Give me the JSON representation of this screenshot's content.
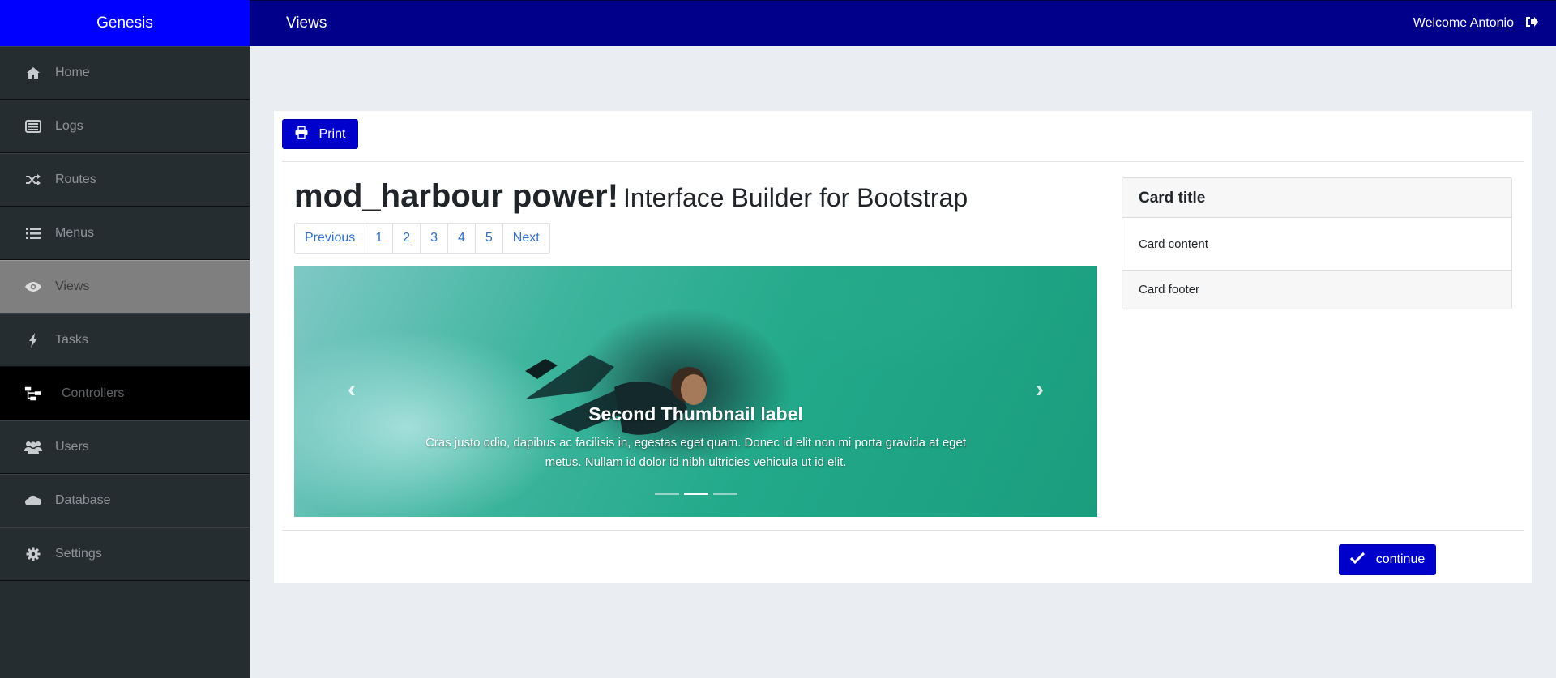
{
  "brand": {
    "name": "Genesis"
  },
  "topbar": {
    "title": "Views",
    "welcome": "Welcome Antonio",
    "logout_icon": "sign-out-icon"
  },
  "sidebar": {
    "items": [
      {
        "label": "Home",
        "icon": "home-icon"
      },
      {
        "label": "Logs",
        "icon": "list-alt-icon"
      },
      {
        "label": "Routes",
        "icon": "random-icon"
      },
      {
        "label": "Menus",
        "icon": "list-icon"
      },
      {
        "label": "Views",
        "icon": "eye-icon",
        "state": "active"
      },
      {
        "label": "Tasks",
        "icon": "bolt-icon"
      },
      {
        "label": "Controllers",
        "icon": "sitemap-icon",
        "state": "hover"
      },
      {
        "label": "Users",
        "icon": "users-icon"
      },
      {
        "label": "Database",
        "icon": "cloud-icon"
      },
      {
        "label": "Settings",
        "icon": "gear-icon"
      }
    ]
  },
  "toolbar": {
    "print_label": "Print"
  },
  "heading": {
    "main": "mod_harbour power!",
    "sub": "Interface Builder for Bootstrap"
  },
  "pagination": {
    "prev": "Previous",
    "pages": [
      "1",
      "2",
      "3",
      "4",
      "5"
    ],
    "next": "Next"
  },
  "carousel": {
    "caption_title": "Second Thumbnail label",
    "caption_text": "Cras justo odio, dapibus ac facilisis in, egestas eget quam. Donec id elit non mi porta gravida at eget metus. Nullam id dolor id nibh ultricies vehicula ut id elit.",
    "slide_count": 3,
    "active_slide": 2
  },
  "card": {
    "title": "Card title",
    "content": "Card content",
    "footer": "Card footer"
  },
  "actions": {
    "continue_label": "continue"
  },
  "colors": {
    "brand": "#0000ff",
    "topbar": "#00008b",
    "button": "#0000cc",
    "sidebar": "#262d31",
    "link": "#2f6fc7"
  }
}
